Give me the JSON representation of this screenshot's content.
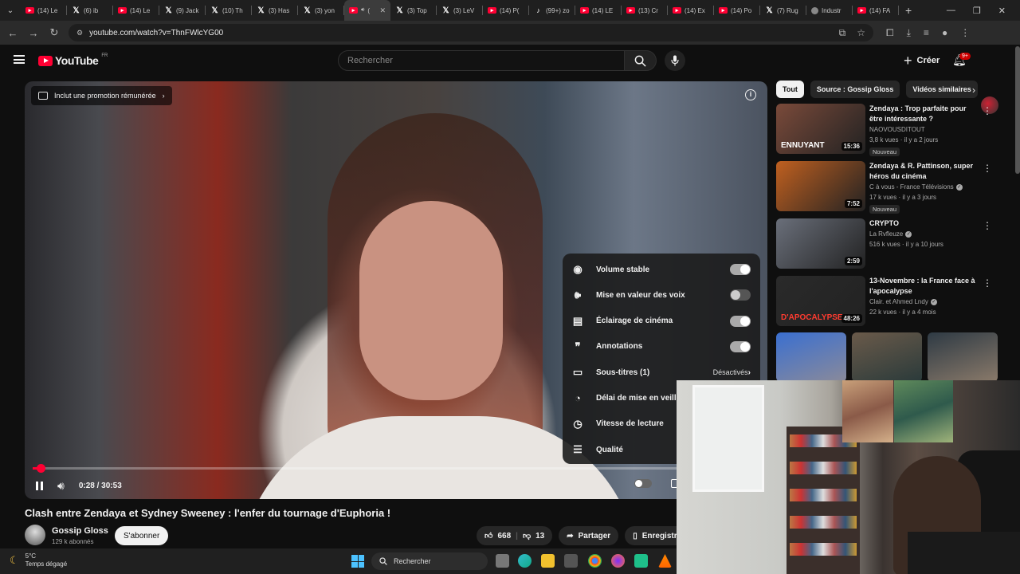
{
  "browser": {
    "tabs": [
      {
        "icon": "youtube-icon",
        "label": "(14) Le"
      },
      {
        "icon": "x-icon",
        "label": "(6) ib"
      },
      {
        "icon": "youtube-icon",
        "label": "(14) Le"
      },
      {
        "icon": "x-icon",
        "label": "(9) Jack"
      },
      {
        "icon": "x-icon",
        "label": "(10) Th"
      },
      {
        "icon": "x-icon",
        "label": "(3) Has"
      },
      {
        "icon": "x-icon",
        "label": "(3) yon"
      },
      {
        "icon": "youtube-icon",
        "label": "(",
        "active": true
      },
      {
        "icon": "x-icon",
        "label": "(3) Top"
      },
      {
        "icon": "x-icon",
        "label": "(3) LeV"
      },
      {
        "icon": "youtube-icon",
        "label": "(14) P("
      },
      {
        "icon": "tiktok-icon",
        "label": "(99+) zo"
      },
      {
        "icon": "youtube-icon",
        "label": "(14) LE"
      },
      {
        "icon": "youtube-icon",
        "label": "(13) Cr"
      },
      {
        "icon": "youtube-icon",
        "label": "(14) Ex"
      },
      {
        "icon": "youtube-icon",
        "label": "(14) Po"
      },
      {
        "icon": "x-icon",
        "label": "(7) Rug"
      },
      {
        "icon": "globe-icon",
        "label": "Industr"
      },
      {
        "icon": "youtube-icon",
        "label": "(14) FA"
      }
    ],
    "url": "youtube.com/watch?v=ThnFWlcYG00"
  },
  "youtube": {
    "logo_text": "YouTube",
    "region": "FR",
    "search_placeholder": "Rechercher",
    "create_label": "Créer",
    "notif_count": "9+"
  },
  "video": {
    "promo_label": "Inclut une promotion rémunérée",
    "current_time": "0:28",
    "duration": "30:53",
    "timecode": "0:28 / 30:53",
    "progress": 0.015,
    "title": "Clash entre Zendaya et Sydney Sweeney : l'enfer du tournage d'Euphoria !",
    "channel": "Gossip Gloss",
    "subscribers": "129 k abonnés",
    "subscribe_label": "S'abonner",
    "likes": "668",
    "dislikes": "13",
    "share_label": "Partager",
    "save_label": "Enregistr"
  },
  "settings_menu": [
    {
      "icon": "stable-volume-icon",
      "label": "Volume stable",
      "type": "toggle",
      "on": true
    },
    {
      "icon": "voice-boost-icon",
      "label": "Mise en valeur des voix",
      "type": "toggle",
      "on": false
    },
    {
      "icon": "ambient-mode-icon",
      "label": "Éclairage de cinéma",
      "type": "toggle",
      "on": true
    },
    {
      "icon": "annotations-icon",
      "label": "Annotations",
      "type": "toggle",
      "on": true
    },
    {
      "icon": "subtitles-icon",
      "label": "Sous-titres (1)",
      "type": "value",
      "value": "Désactivés"
    },
    {
      "icon": "sleep-timer-icon",
      "label": "Délai de mise en veille",
      "type": "link"
    },
    {
      "icon": "playback-speed-icon",
      "label": "Vitesse de lecture",
      "type": "link"
    },
    {
      "icon": "quality-icon",
      "label": "Qualité",
      "type": "link"
    }
  ],
  "chips": [
    "Tout",
    "Source : Gossip Gloss",
    "Vidéos similaires"
  ],
  "recommendations": [
    {
      "title": "Zendaya : Trop parfaite pour être intéressante ?",
      "channel": "NAOVOUSDITOUT",
      "stats": "3,8 k vues · il y a 2 jours",
      "badge": "Nouveau",
      "duration": "15:36",
      "thumb_text": "ENNUYANT",
      "verified": false,
      "thumb_color": "#7a4a3a"
    },
    {
      "title": "Zendaya & R. Pattinson, super héros du cinéma",
      "channel": "C à vous - France Télévisions",
      "stats": "17 k vues · il y a 3 jours",
      "badge": "Nouveau",
      "duration": "7:52",
      "thumb_text": "",
      "verified": true,
      "thumb_color": "#c06020"
    },
    {
      "title": "CRYPTO",
      "channel": "La Rvfleuze",
      "stats": "516 k vues · il y a 10 jours",
      "badge": "",
      "duration": "2:59",
      "thumb_text": "",
      "verified": true,
      "thumb_color": "#6a6f7a"
    },
    {
      "title": "13-Novembre : la France face à l'apocalypse",
      "channel": "Clair. et Ahmed Lndy",
      "stats": "22 k vues · il y a 4 mois",
      "badge": "",
      "duration": "48:26",
      "thumb_text": "D'APOCALYPSE",
      "verified": true,
      "thumb_color": "#2a2a2a"
    }
  ],
  "taskbar": {
    "temperature": "5°C",
    "weather": "Temps dégagé",
    "search_label": "Rechercher"
  },
  "colors": {
    "accent": "#ff0033",
    "background": "#0f0f0f"
  }
}
